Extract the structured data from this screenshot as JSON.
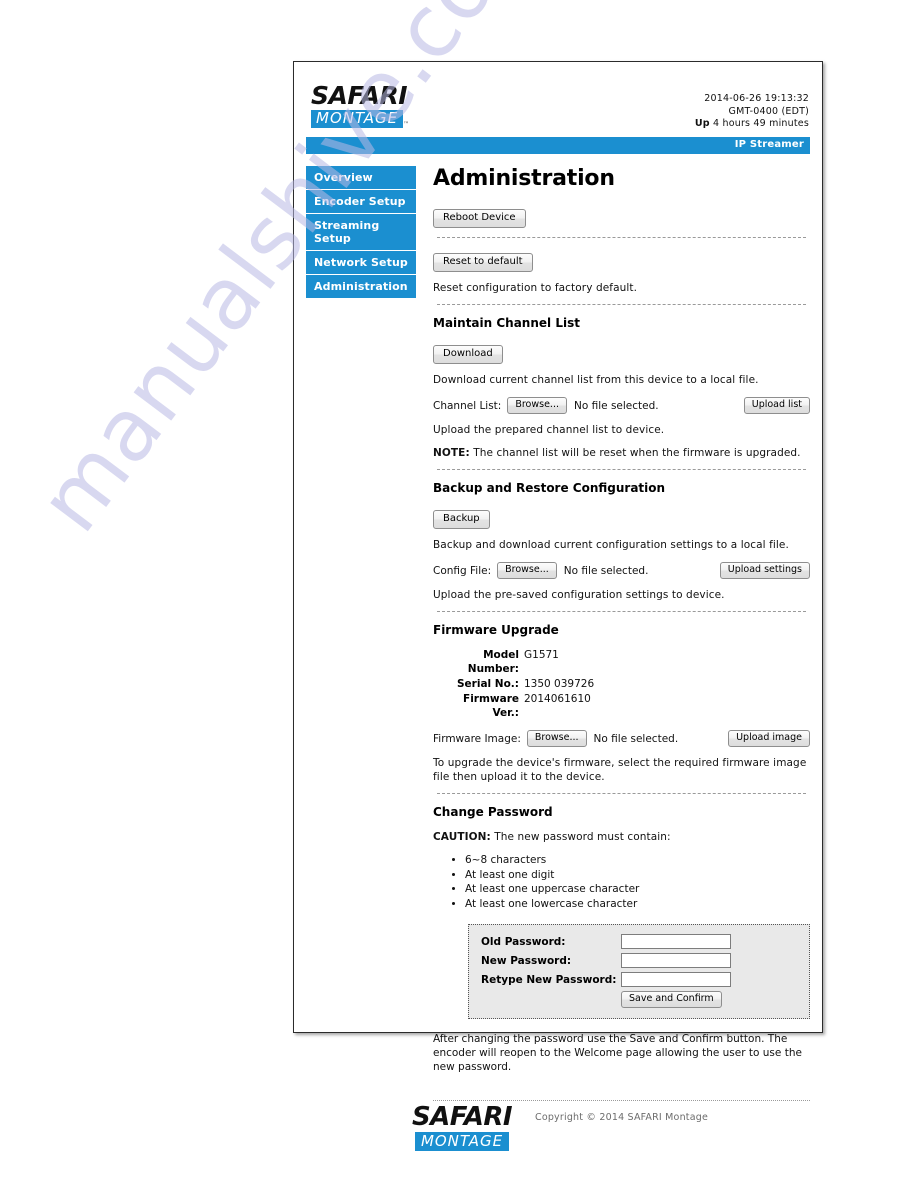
{
  "brand": {
    "logo_top": "SAFARI",
    "logo_bottom": "MONTAGE",
    "trademark": "™"
  },
  "header": {
    "datetime": "2014-06-26 19:13:32",
    "timezone": "GMT-0400 (EDT)",
    "uptime_label": "Up",
    "uptime_value": "4 hours 49 minutes",
    "device_banner": "IP Streamer",
    "accent_color": "#1b8fd0"
  },
  "sidebar": {
    "items": [
      {
        "label": "Overview"
      },
      {
        "label": "Encoder Setup"
      },
      {
        "label": "Streaming Setup"
      },
      {
        "label": "Network Setup"
      },
      {
        "label": "Administration"
      }
    ]
  },
  "main": {
    "page_title": "Administration",
    "reboot": {
      "button": "Reboot Device"
    },
    "reset": {
      "button": "Reset to default",
      "description": "Reset configuration to factory default."
    },
    "channel_list": {
      "heading": "Maintain Channel List",
      "download_button": "Download",
      "download_description": "Download current channel list from this device to a local file.",
      "file_label": "Channel List:",
      "browse_button": "Browse...",
      "no_file_text": "No file selected.",
      "upload_button": "Upload list",
      "upload_description": "Upload the prepared channel list to device.",
      "note_label": "NOTE:",
      "note_text": " The channel list will be reset when the firmware is upgraded."
    },
    "backup_restore": {
      "heading": "Backup and Restore Configuration",
      "backup_button": "Backup",
      "backup_description": "Backup and download current configuration settings to a local file.",
      "file_label": "Config File:",
      "browse_button": "Browse...",
      "no_file_text": "No file selected.",
      "upload_button": "Upload settings",
      "upload_description": "Upload the pre-saved configuration settings to device."
    },
    "firmware": {
      "heading": "Firmware Upgrade",
      "model_label": "Model Number:",
      "model_value": "G1571",
      "serial_label": "Serial No.:",
      "serial_value": "1350 039726",
      "version_label": "Firmware Ver.:",
      "version_value": "2014061610",
      "image_label": "Firmware Image:",
      "browse_button": "Browse...",
      "no_file_text": "No file selected.",
      "upload_button": "Upload image",
      "description": "To upgrade the device's firmware, select the required firmware image file then upload it to the device."
    },
    "password": {
      "heading": "Change Password",
      "caution_label": "CAUTION:",
      "caution_text": " The new password must contain:",
      "rules": [
        "6~8 characters",
        "At least one digit",
        "At least one uppercase character",
        "At least one lowercase character"
      ],
      "old_label": "Old Password:",
      "old_value": "",
      "new_label": "New Password:",
      "new_value": "",
      "retype_label": "Retype New Password:",
      "retype_value": "",
      "save_button": "Save and Confirm",
      "footer_text": "After changing the password use the Save and Confirm button. The encoder will reopen to the Welcome page allowing the user to use the new password."
    }
  },
  "footer": {
    "copyright": "Copyright © 2014 SAFARI Montage"
  },
  "watermark": {
    "text": "manualshive.com"
  }
}
